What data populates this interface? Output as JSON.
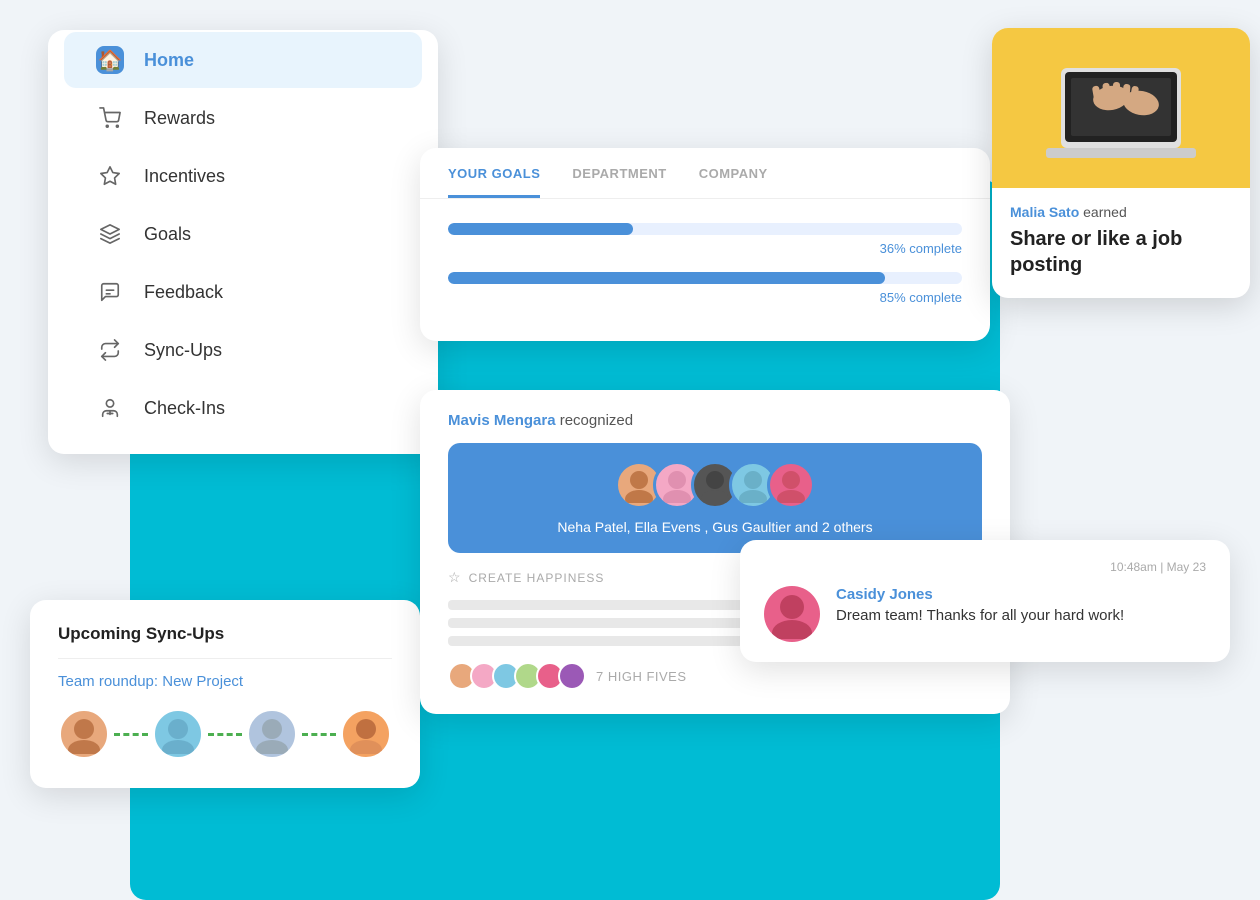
{
  "sidebar": {
    "items": [
      {
        "label": "Home",
        "icon": "🏠",
        "active": true
      },
      {
        "label": "Rewards",
        "icon": "🛒",
        "active": false
      },
      {
        "label": "Incentives",
        "icon": "⭐",
        "active": false
      },
      {
        "label": "Goals",
        "icon": "📐",
        "active": false
      },
      {
        "label": "Feedback",
        "icon": "💬",
        "active": false
      },
      {
        "label": "Sync-Ups",
        "icon": "🔄",
        "active": false
      },
      {
        "label": "Check-Ins",
        "icon": "💭",
        "active": false
      }
    ]
  },
  "syncups": {
    "title": "Upcoming Sync-Ups",
    "link": "Team roundup: New Project"
  },
  "goals": {
    "tabs": [
      "YOUR GOALS",
      "DEPARTMENT",
      "COMPANY"
    ],
    "active_tab": "YOUR GOALS",
    "progress_bars": [
      {
        "percent": 36,
        "label": "36% complete"
      },
      {
        "percent": 85,
        "label": "85% complete"
      }
    ]
  },
  "recognition": {
    "user": "Mavis Mengara",
    "action": "recognized",
    "names": "Neha Patel, Ella Evens , Gus Gaultier and 2 others",
    "create_happiness": "CREATE HAPPINESS",
    "high_fives_count": "7 HIGH FIVES"
  },
  "achievement": {
    "user": "Malia Sato",
    "action": "earned",
    "title": "Share or like a job posting"
  },
  "comment": {
    "timestamp": "10:48am | May 23",
    "user": "Casidy Jones",
    "text": "Dream team!  Thanks for all your hard work!"
  }
}
